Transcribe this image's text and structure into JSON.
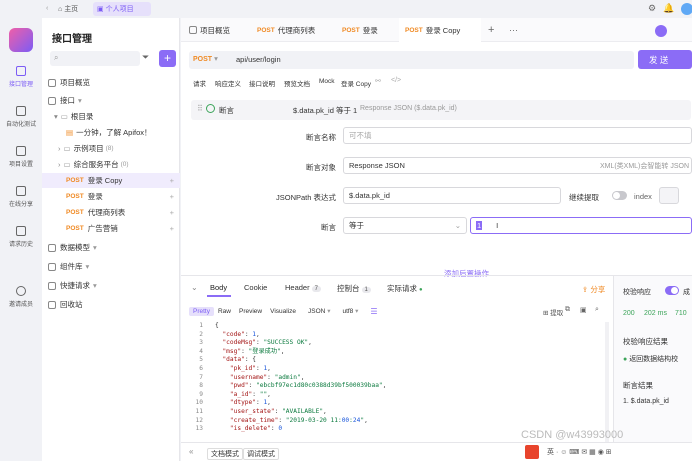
{
  "topbar": {
    "home_label": "主页",
    "project_tab_label": "个人项目"
  },
  "rail": {
    "items": [
      {
        "label": "接口管理"
      },
      {
        "label": "自动化测试"
      },
      {
        "label": "项目设置"
      },
      {
        "label": "在线分享"
      },
      {
        "label": "请求历史"
      },
      {
        "label": "邀请成员"
      }
    ]
  },
  "sidebar": {
    "title": "接口管理",
    "add_label": "+",
    "items": [
      {
        "label": "项目概览"
      },
      {
        "label": "接口"
      },
      {
        "label": "根目录"
      },
      {
        "label": "一分钟，了解 Apifox！"
      },
      {
        "label": "示例项目",
        "count": "(8)"
      },
      {
        "label": "综合服务平台",
        "count": "(0)"
      },
      {
        "method": "POST",
        "label": "登录 Copy"
      },
      {
        "method": "POST",
        "label": "登录"
      },
      {
        "method": "POST",
        "label": "代理商列表"
      },
      {
        "method": "POST",
        "label": "广告营销"
      },
      {
        "label": "数据模型"
      },
      {
        "label": "组件库"
      },
      {
        "label": "快捷请求"
      },
      {
        "label": "回收站"
      }
    ]
  },
  "tabs": [
    {
      "label": "项目概览"
    },
    {
      "method": "POST",
      "label": "代理商列表"
    },
    {
      "method": "POST",
      "label": "登录"
    },
    {
      "method": "POST",
      "label": "登录 Copy"
    }
  ],
  "request": {
    "method": "POST",
    "url": "api/user/login",
    "send_label": "发 送"
  },
  "subtabs": [
    "请求",
    "响应定义",
    "接口说明",
    "预览文档",
    "Mock",
    "登录 Copy"
  ],
  "assertion": {
    "label": "断言",
    "summary": "$.data.pk_id 等于 1",
    "summary_hint": "Response JSON ($.data.pk_id)",
    "name_label": "断言名称",
    "name_placeholder": "可不填",
    "target_label": "断言对象",
    "target_value": "Response JSON",
    "target_hint": "XML(类XML)会智能转 JSON",
    "jsonpath_label": "JSONPath 表达式",
    "jsonpath_value": "$.data.pk_id",
    "continue_label": "继续提取",
    "index_label": "index",
    "op_label": "断言",
    "op_value": "等于",
    "expected_value": "1",
    "add_post_label": "添加后置操作"
  },
  "response_tabs": [
    {
      "label": "Body"
    },
    {
      "label": "Cookie"
    },
    {
      "label": "Header",
      "badge": "7"
    },
    {
      "label": "控制台",
      "badge": "1"
    },
    {
      "label": "实际请求"
    }
  ],
  "share_label": "分享",
  "viewer": {
    "modes": [
      "Pretty",
      "Raw",
      "Preview",
      "Visualize"
    ],
    "format": "JSON",
    "encoding": "utf8",
    "extract_label": "提取"
  },
  "code_lines": [
    "{",
    "  \"code\": 1,",
    "  \"codeMsg\": \"SUCCESS OK\",",
    "  \"msg\": \"登录成功\",",
    "  \"data\": {",
    "    \"pk_id\": 1,",
    "    \"username\": \"admin\",",
    "    \"pwd\": \"ebcbf97ec1d80c0388d39bf500039baa\",",
    "    \"a_id\": \"\",",
    "    \"dtype\": 1,",
    "    \"user_state\": \"AVAILABLE\",",
    "    \"create_time\": \"2019-03-20 11:00:24\",",
    "    \"is_delete\": 0"
  ],
  "side_panel": {
    "validate_label": "校验响应",
    "status": "200",
    "time": "202 ms",
    "size": "710",
    "validate_result_label": "校验响应结果",
    "validate_result": "返回数据结构校",
    "assert_result_label": "断言结果",
    "assert_result": "1. $.data.pk_id"
  },
  "bottom": {
    "doc_mode": "文档模式",
    "debug_mode": "调试模式",
    "watermark": "CSDN @w43993000"
  }
}
